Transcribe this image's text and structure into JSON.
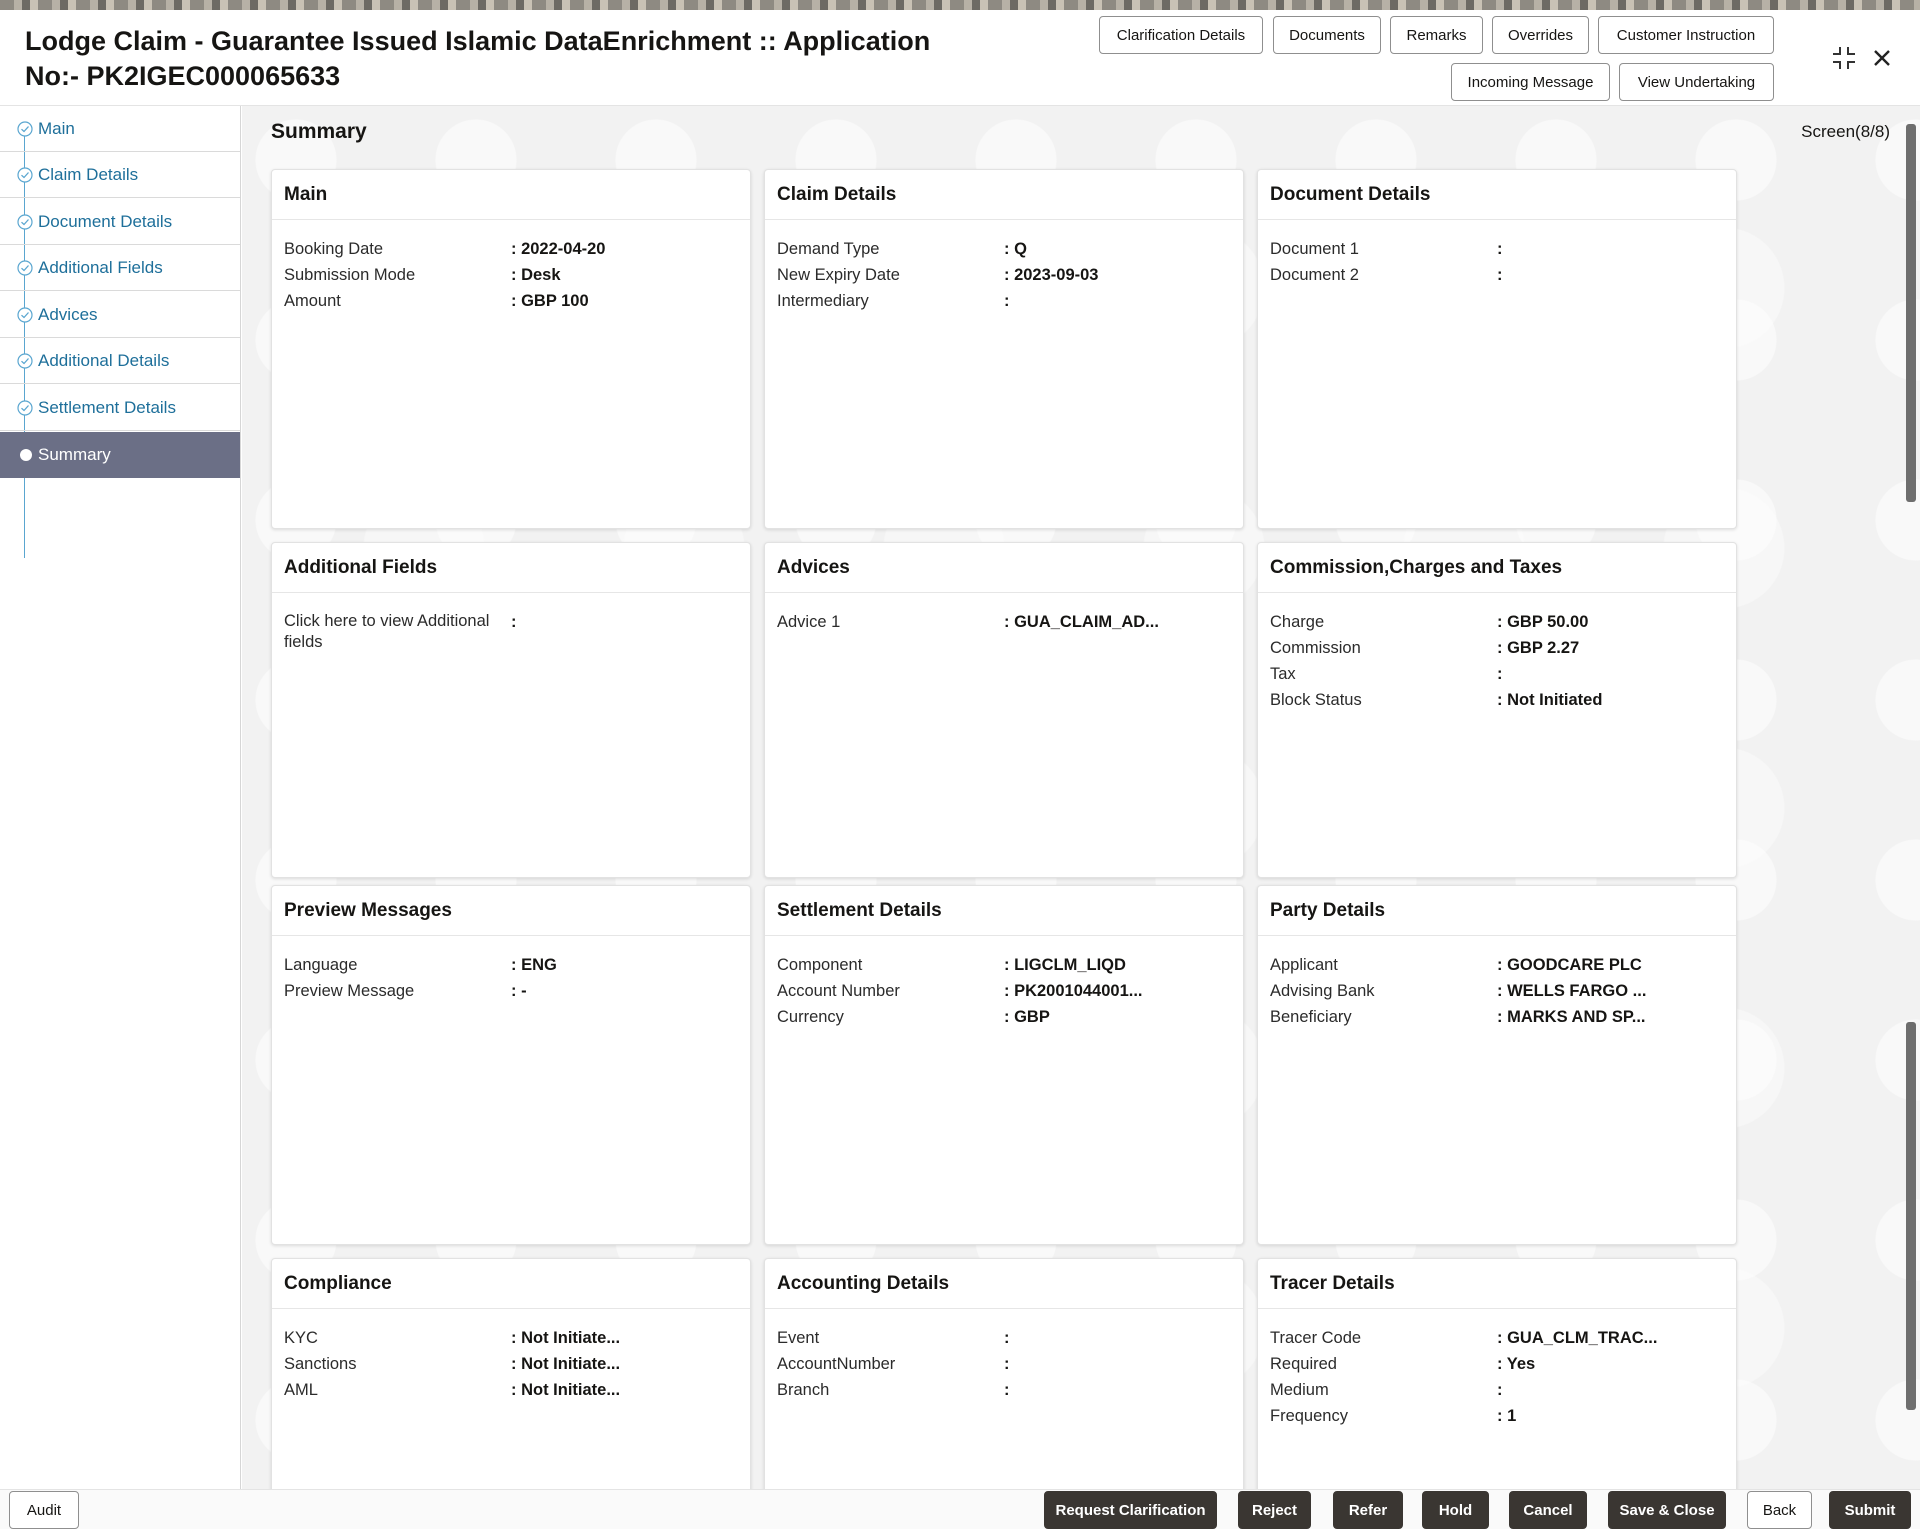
{
  "header": {
    "title": "Lodge Claim - Guarantee Issued Islamic DataEnrichment :: Application No:- PK2IGEC000065633",
    "buttons": {
      "clarification": "Clarification Details",
      "documents": "Documents",
      "remarks": "Remarks",
      "overrides": "Overrides",
      "customer_instruction": "Customer Instruction",
      "incoming_message": "Incoming Message",
      "view_undertaking": "View Undertaking"
    }
  },
  "sidebar": {
    "items": [
      {
        "label": "Main"
      },
      {
        "label": "Claim Details"
      },
      {
        "label": "Document Details"
      },
      {
        "label": "Additional Fields"
      },
      {
        "label": "Advices"
      },
      {
        "label": "Additional Details"
      },
      {
        "label": "Settlement Details"
      },
      {
        "label": "Summary"
      }
    ],
    "active_index": 7
  },
  "summary": {
    "title": "Summary",
    "screen": "Screen(8/8)"
  },
  "cards": {
    "main": {
      "title": "Main",
      "rows": [
        {
          "label": "Booking Date",
          "value": ": 2022-04-20"
        },
        {
          "label": "Submission Mode",
          "value": ": Desk"
        },
        {
          "label": "Amount",
          "value": ": GBP 100"
        }
      ]
    },
    "claim": {
      "title": "Claim Details",
      "rows": [
        {
          "label": "Demand Type",
          "value": ": Q"
        },
        {
          "label": "New Expiry Date",
          "value": ": 2023-09-03"
        },
        {
          "label": "Intermediary",
          "value": ":"
        }
      ]
    },
    "document": {
      "title": "Document Details",
      "rows": [
        {
          "label": "Document 1",
          "value": ":"
        },
        {
          "label": "Document 2",
          "value": ":"
        }
      ]
    },
    "additional_fields": {
      "title": "Additional Fields",
      "rows": [
        {
          "label": "Click here to view Additional fields",
          "value": ":"
        }
      ]
    },
    "advices": {
      "title": "Advices",
      "rows": [
        {
          "label": "Advice 1",
          "value": ": GUA_CLAIM_AD..."
        }
      ]
    },
    "commission": {
      "title": "Commission,Charges and Taxes",
      "rows": [
        {
          "label": "Charge",
          "value": ": GBP  50.00"
        },
        {
          "label": "Commission",
          "value": ": GBP  2.27"
        },
        {
          "label": "Tax",
          "value": ":"
        },
        {
          "label": "Block Status",
          "value": ": Not Initiated"
        }
      ]
    },
    "preview": {
      "title": "Preview Messages",
      "rows": [
        {
          "label": "Language",
          "value": ": ENG"
        },
        {
          "label": "Preview Message",
          "value": ": -"
        }
      ]
    },
    "settlement": {
      "title": "Settlement Details",
      "rows": [
        {
          "label": "Component",
          "value": ": LIGCLM_LIQD"
        },
        {
          "label": "Account Number",
          "value": ": PK2001044001..."
        },
        {
          "label": "Currency",
          "value": ": GBP"
        }
      ]
    },
    "party": {
      "title": "Party Details",
      "rows": [
        {
          "label": "Applicant",
          "value": ": GOODCARE PLC"
        },
        {
          "label": "Advising Bank",
          "value": ": WELLS FARGO ..."
        },
        {
          "label": "Beneficiary",
          "value": ": MARKS AND SP..."
        }
      ]
    },
    "compliance": {
      "title": "Compliance",
      "rows": [
        {
          "label": "KYC",
          "value": ": Not Initiate..."
        },
        {
          "label": "Sanctions",
          "value": ": Not Initiate..."
        },
        {
          "label": "AML",
          "value": ": Not Initiate..."
        }
      ]
    },
    "accounting": {
      "title": "Accounting Details",
      "rows": [
        {
          "label": "Event",
          "value": ":"
        },
        {
          "label": "AccountNumber",
          "value": ":"
        },
        {
          "label": "Branch",
          "value": ":"
        }
      ]
    },
    "tracer": {
      "title": "Tracer Details",
      "rows": [
        {
          "label": "Tracer Code",
          "value": ": GUA_CLM_TRAC..."
        },
        {
          "label": "Required",
          "value": ": Yes"
        },
        {
          "label": "Medium",
          "value": ":"
        },
        {
          "label": "Frequency",
          "value": ": 1"
        }
      ]
    }
  },
  "footer": {
    "audit": "Audit",
    "request_clarification": "Request Clarification",
    "reject": "Reject",
    "refer": "Refer",
    "hold": "Hold",
    "cancel": "Cancel",
    "save_close": "Save & Close",
    "back": "Back",
    "submit": "Submit"
  }
}
